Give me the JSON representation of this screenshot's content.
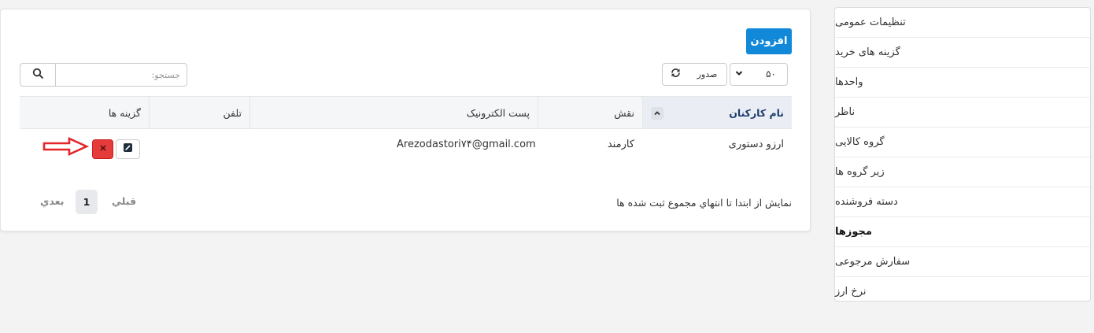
{
  "main": {
    "add_label": "افزودن",
    "search_placeholder": "جستجو:",
    "export_label": "صدور",
    "page_size": "۵۰",
    "columns": [
      "نام کارکنان",
      "نقش",
      "پست الکترونیک",
      "تلفن",
      "گزینه ها"
    ],
    "rows": [
      {
        "name": "ارزو دستوری",
        "role": "کارمند",
        "email": "Arezodastori۷۴@gmail.com",
        "phone": ""
      }
    ],
    "pager": {
      "info": "نمايش از ابتدا تا انتهاي مجموع ثبت شده ها",
      "prev": "قبلي",
      "current": "1",
      "next": "بعدي"
    }
  },
  "sidebar": {
    "active": "مجوزها",
    "items": [
      {
        "label": "تنظیمات عمومی"
      },
      {
        "label": "گزینه های خرید"
      },
      {
        "label": "واحدها"
      },
      {
        "label": "ناظر"
      },
      {
        "label": "گروه کالایی"
      },
      {
        "label": "زیر گروه ها"
      },
      {
        "label": "دسته فروشنده"
      },
      {
        "label": "مجوزها"
      },
      {
        "label": "سفارش مرجوعی"
      },
      {
        "label": "نرخ ارز"
      }
    ]
  },
  "colors": {
    "accent": "#1188d8",
    "danger": "#e53b3b",
    "annotation": "#e2262b"
  }
}
